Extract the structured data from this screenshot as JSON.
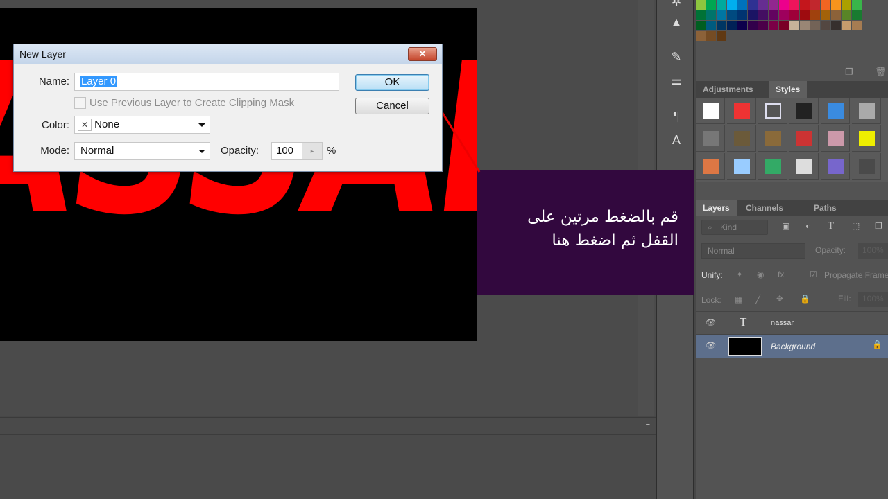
{
  "canvas": {
    "text": "ASSAR",
    "text_color": "#ff0000"
  },
  "dialog": {
    "title": "New Layer",
    "close_label": "✕",
    "name_label": "Name:",
    "name_value": "Layer 0",
    "clip_label": "Use Previous Layer to Create Clipping Mask",
    "clip_checked": false,
    "color_label": "Color:",
    "color_value": "None",
    "color_icon": "✕",
    "mode_label": "Mode:",
    "mode_value": "Normal",
    "opacity_label": "Opacity:",
    "opacity_value": "100",
    "opacity_unit": "%",
    "ok_label": "OK",
    "cancel_label": "Cancel"
  },
  "overlay": {
    "line1": "قم بالضغط مرتين على",
    "line2": "القفل ثم اضغط هنا",
    "bg": "#32083e"
  },
  "styles_panel": {
    "tabs": [
      "Adjustments",
      "Styles"
    ],
    "active_tab": "Styles"
  },
  "layers_panel": {
    "tabs": [
      "Layers",
      "Channels",
      "Paths"
    ],
    "active_tab": "Layers",
    "filter_label": "Kind",
    "blend_mode": "Normal",
    "opacity_label": "Opacity:",
    "opacity_value": "100%",
    "unify_label": "Unify:",
    "propagate_label": "Propagate Frame",
    "lock_label": "Lock:",
    "fill_label": "Fill:",
    "fill_value": "100%",
    "layers": [
      {
        "name": "nassar",
        "type": "text",
        "thumb": "T",
        "visible": true,
        "selected": false
      },
      {
        "name": "Background",
        "type": "image",
        "visible": true,
        "selected": true,
        "locked": true
      }
    ]
  },
  "bottom_panel": {
    "menu_icon": "≡"
  }
}
